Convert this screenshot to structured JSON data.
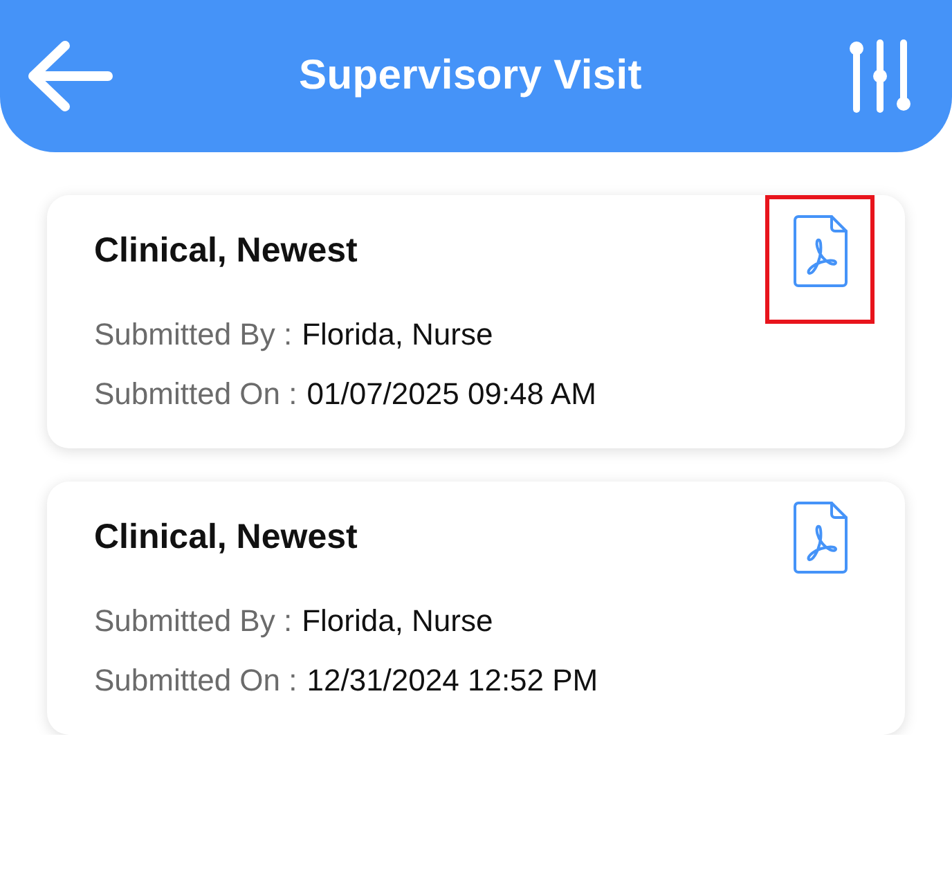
{
  "header": {
    "title": "Supervisory Visit"
  },
  "records": [
    {
      "title": "Clinical, Newest",
      "highlighted": true,
      "fields": [
        {
          "label": "Submitted By :",
          "value": "Florida, Nurse"
        },
        {
          "label": "Submitted On :",
          "value": "01/07/2025 09:48 AM"
        }
      ]
    },
    {
      "title": "Clinical, Newest",
      "highlighted": false,
      "fields": [
        {
          "label": "Submitted By :",
          "value": "Florida, Nurse"
        },
        {
          "label": "Submitted On :",
          "value": "12/31/2024 12:52 PM"
        }
      ]
    }
  ]
}
